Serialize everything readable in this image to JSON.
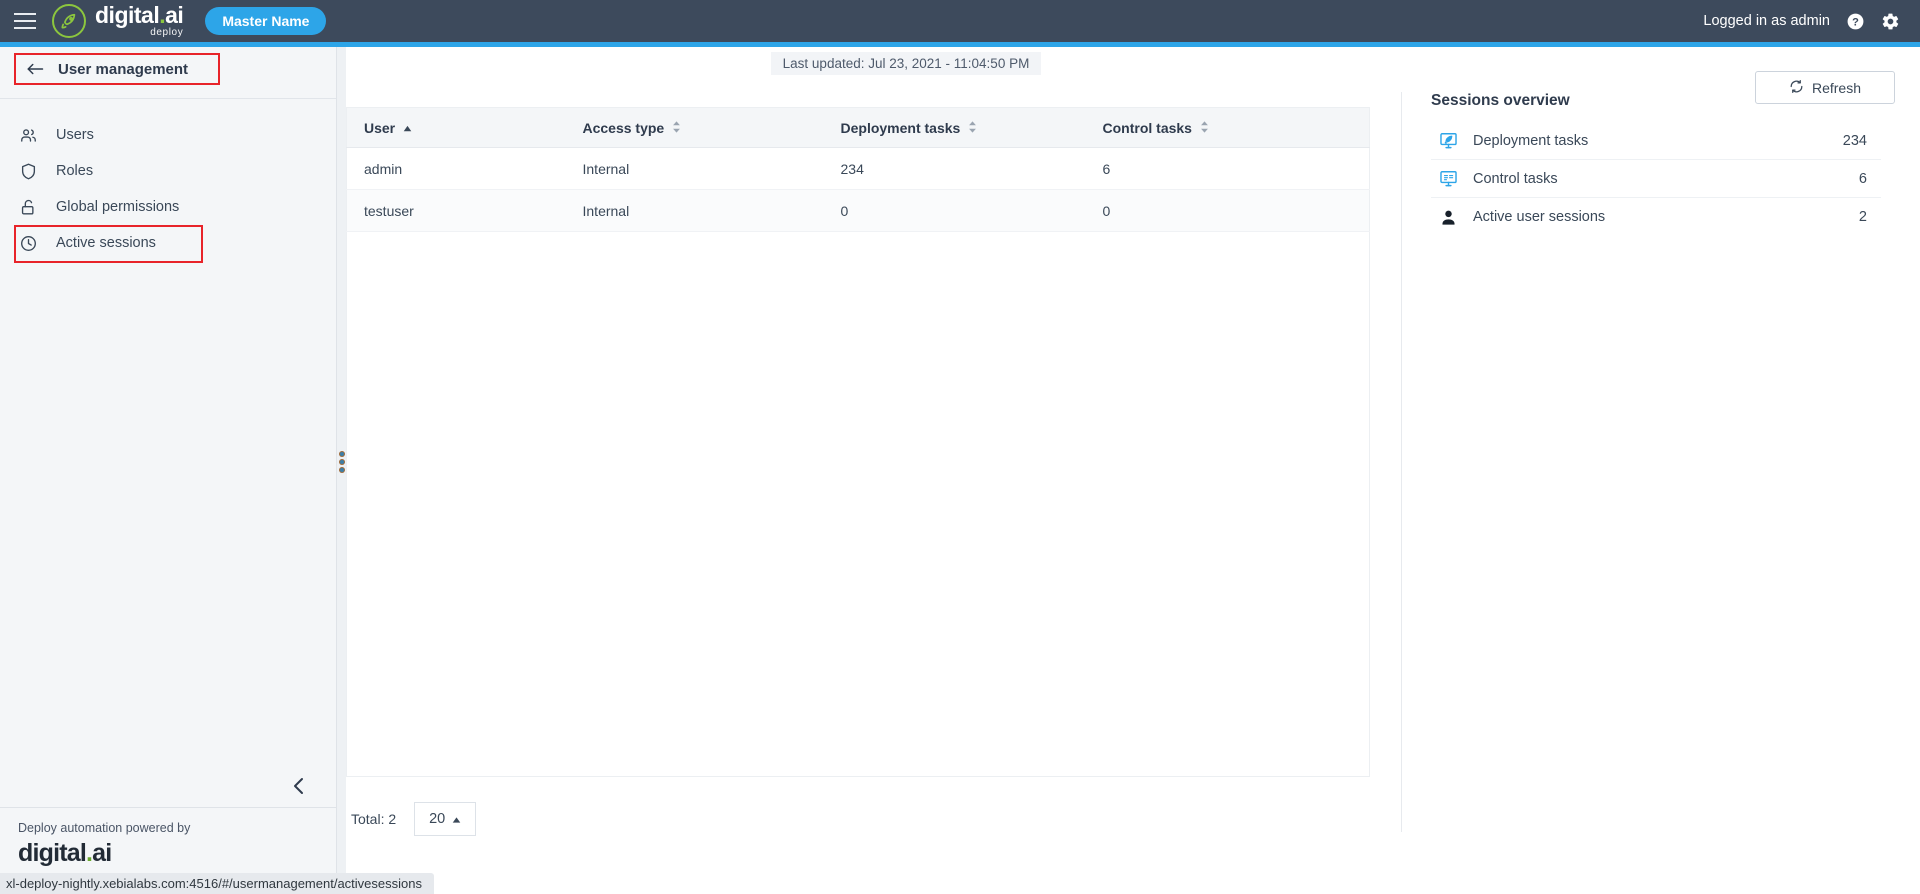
{
  "topbar": {
    "menu_icon": "hamburger-icon",
    "logo_main": "digital",
    "logo_dot": ".",
    "logo_ai": "ai",
    "logo_sub": "deploy",
    "master_badge": "Master Name",
    "logged_in_label": "Logged in as admin",
    "help_icon": "help-icon",
    "settings_icon": "gear-icon",
    "accent_color": "#2da5e8",
    "bar_color": "#3d4a5c"
  },
  "sidebar": {
    "header_title": "User management",
    "back_icon": "arrow-left-icon",
    "items": [
      {
        "label": "Users",
        "icon": "users-icon",
        "highlight": false
      },
      {
        "label": "Roles",
        "icon": "shield-icon",
        "highlight": false
      },
      {
        "label": "Global permissions",
        "icon": "unlock-icon",
        "highlight": false
      },
      {
        "label": "Active sessions",
        "icon": "clock-icon",
        "highlight": true
      }
    ],
    "collapse_icon": "chevron-left-icon",
    "footer_caption": "Deploy automation powered by",
    "footer_logo_main": "digital",
    "footer_logo_dot": ".",
    "footer_logo_ai": "ai",
    "highlight_color": "#e8242a"
  },
  "main": {
    "last_updated": "Last updated: Jul 23, 2021 - 11:04:50 PM",
    "refresh_label": "Refresh",
    "refresh_icon": "refresh-icon"
  },
  "table": {
    "columns": [
      {
        "label": "User",
        "sort": "asc",
        "sort_icon": "sort-asc-icon"
      },
      {
        "label": "Access type",
        "sort": "none",
        "sort_icon": "sort-none-icon"
      },
      {
        "label": "Deployment tasks",
        "sort": "none",
        "sort_icon": "sort-none-icon"
      },
      {
        "label": "Control tasks",
        "sort": "none",
        "sort_icon": "sort-none-icon"
      }
    ],
    "rows": [
      {
        "user": "admin",
        "access_type": "Internal",
        "deployment_tasks": "234",
        "control_tasks": "6"
      },
      {
        "user": "testuser",
        "access_type": "Internal",
        "deployment_tasks": "0",
        "control_tasks": "0"
      }
    ]
  },
  "pagination": {
    "total_label": "Total: 2",
    "page_size": "20",
    "caret_icon": "caret-up-icon"
  },
  "sessions_overview": {
    "title": "Sessions overview",
    "rows": [
      {
        "label": "Deployment tasks",
        "value": "234",
        "icon": "monitor-rocket-icon"
      },
      {
        "label": "Control tasks",
        "value": "6",
        "icon": "monitor-list-icon"
      },
      {
        "label": "Active user sessions",
        "value": "2",
        "icon": "person-icon"
      }
    ]
  },
  "statusbar": {
    "url": "xl-deploy-nightly.xebialabs.com:4516/#/usermanagement/activesessions"
  }
}
